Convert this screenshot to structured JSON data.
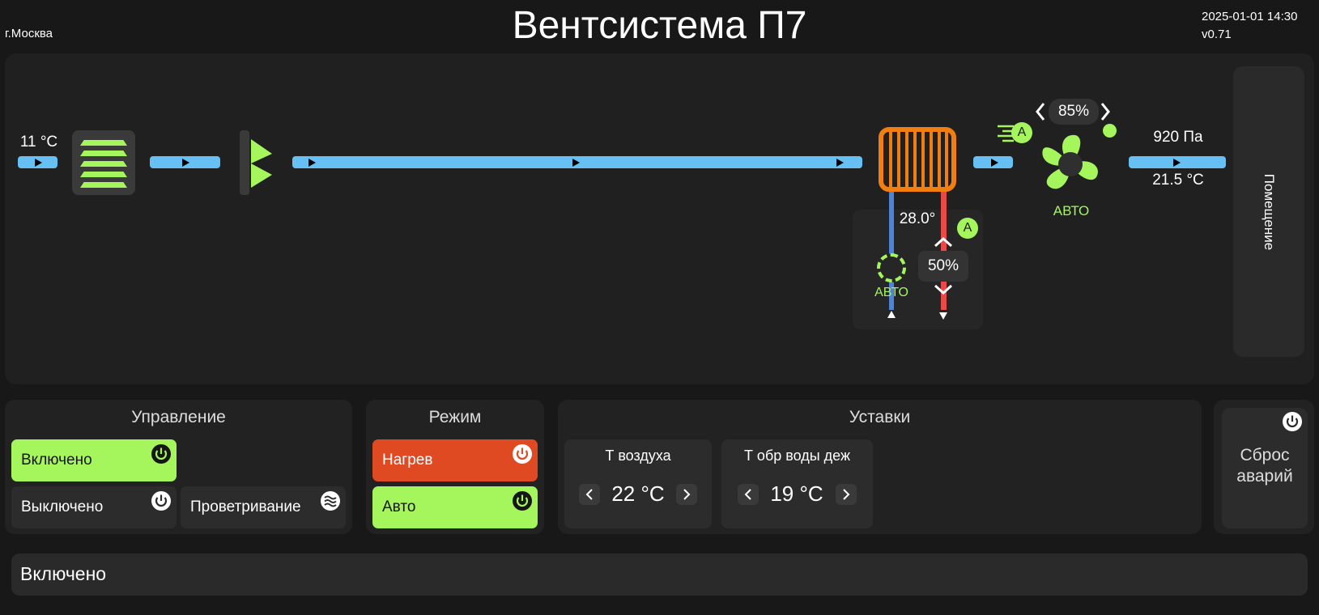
{
  "header": {
    "city": "г.Москва",
    "title": "Вентсистема П7",
    "datetime": "2025-01-01 14:30",
    "version": "v0.71"
  },
  "scheme": {
    "outdoor_temp": "11 °C",
    "heater_temp": "28.0°",
    "auto_badge": "A",
    "pump_mode": "АВТО",
    "valve_percent": "50%",
    "fan_percent": "85%",
    "fan_auto_badge": "A",
    "fan_mode": "АВТО",
    "supply_pressure": "920 Па",
    "supply_temp": "21.5 °C",
    "room_label": "Помещение"
  },
  "control": {
    "title": "Управление",
    "on": "Включено",
    "off": "Выключено",
    "vent": "Проветривание"
  },
  "mode": {
    "title": "Режим",
    "heat": "Нагрев",
    "auto": "Авто"
  },
  "setpoints": {
    "title": "Уставки",
    "air_label": "Т воздуха",
    "air_value": "22 °C",
    "water_label": "Т обр воды деж",
    "water_value": "19 °C"
  },
  "reset": {
    "line1": "Сброс",
    "line2": "аварий"
  },
  "status": {
    "text": "Включено"
  },
  "colors": {
    "accent_green": "#a5f55d",
    "heat_red": "#e04a22",
    "pipe_blue": "#66c0f4",
    "heater_orange": "#f07e10"
  }
}
